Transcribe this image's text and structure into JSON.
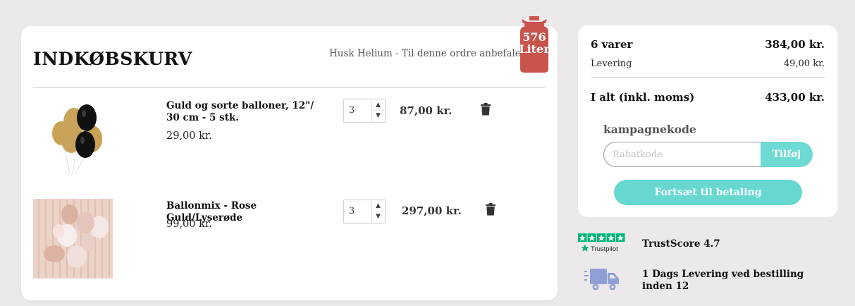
{
  "cart": {
    "title": "INDKØBSKURV",
    "helium_hint": "Husk Helium - Til denne ordre anbefales",
    "helium_amount": "576",
    "helium_unit": "Liter",
    "items": [
      {
        "name": "Guld og sorte balloner, 12\"/ 30 cm - 5 stk.",
        "unit_price": "29,00 kr.",
        "quantity": "3",
        "line_total": "87,00 kr.",
        "image_icon": "gold-black-balloons-image"
      },
      {
        "name": "Ballonmix - Rose Guld/Lyserøde",
        "unit_price": "99,00 kr.",
        "quantity": "3",
        "line_total": "297,00 kr.",
        "image_icon": "rose-gold-balloon-mix-image"
      }
    ]
  },
  "summary": {
    "items_label": "6 varer",
    "items_total": "384,00 kr.",
    "delivery_label": "Levering",
    "delivery_price": "49,00 kr.",
    "total_label": "I alt (inkl. moms)",
    "total_value": "433,00 kr.",
    "coupon_label": "kampagnekode",
    "coupon_placeholder": "Rabatkode",
    "coupon_button": "Tilføj",
    "checkout_button": "Fortsæt til betaling",
    "accent_color": "#67d8d0"
  },
  "trust": {
    "trustpilot_label": "Trustpilot",
    "trustscore": "TrustScore 4.7",
    "delivery_text": "1 Dags Levering ved bestilling inden 12"
  }
}
